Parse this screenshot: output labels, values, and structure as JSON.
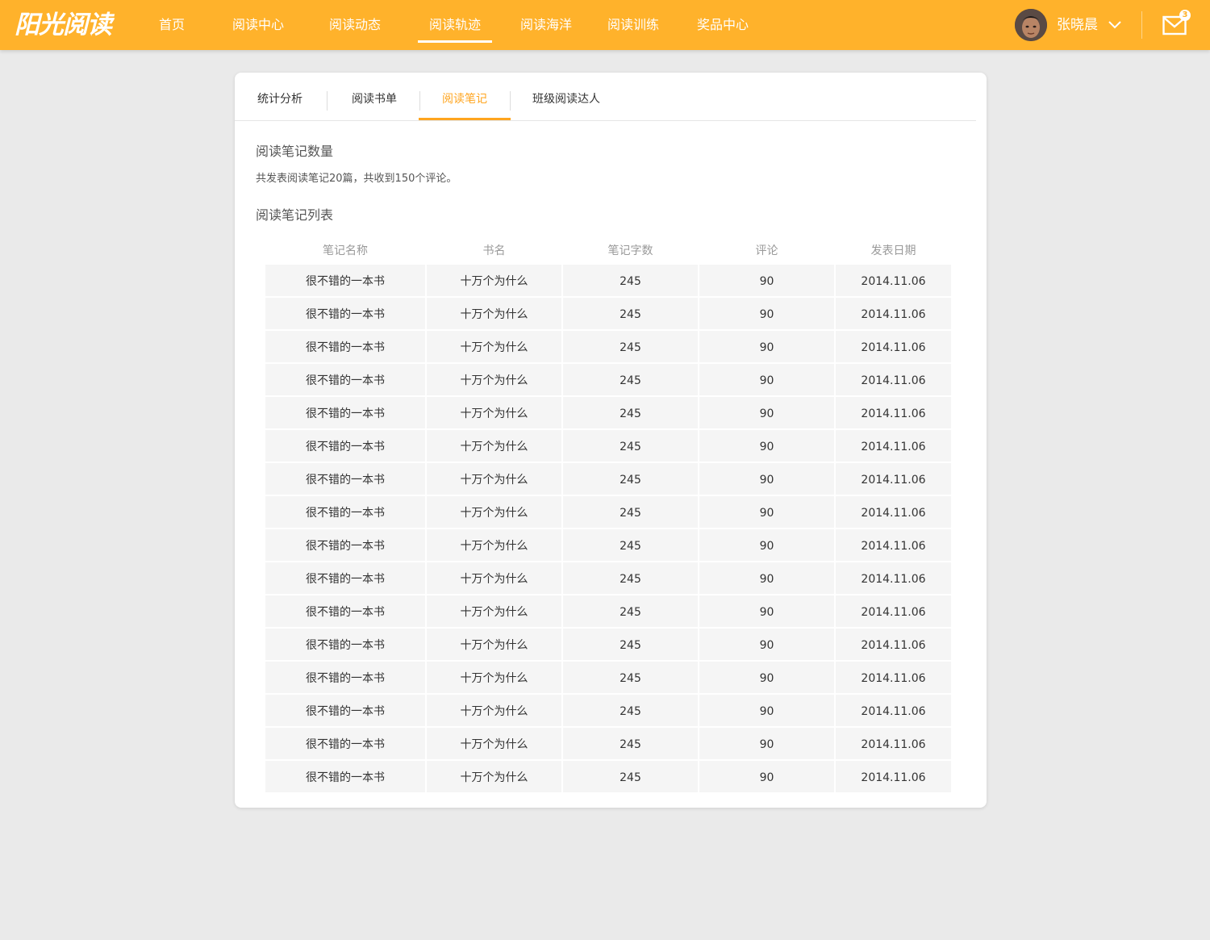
{
  "app": {
    "logo": "阳光阅读"
  },
  "nav": {
    "items": [
      {
        "label": "首页"
      },
      {
        "label": "阅读中心"
      },
      {
        "label": "阅读动态"
      },
      {
        "label": "阅读轨迹",
        "active": true
      },
      {
        "label": "阅读海洋"
      },
      {
        "label": "阅读训练"
      },
      {
        "label": "奖品中心"
      }
    ]
  },
  "user": {
    "name": "张晓晨",
    "message_count": "3"
  },
  "colors": {
    "brand": "#ffb22b",
    "accent": "#ffa51f",
    "cell_bg": "#f5f5f5",
    "page_bg": "#eaeaea"
  },
  "tabs": [
    {
      "label": "统计分析"
    },
    {
      "label": "阅读书单"
    },
    {
      "label": "阅读笔记",
      "active": true
    },
    {
      "label": "班级阅读达人"
    }
  ],
  "notes": {
    "count_title": "阅读笔记数量",
    "summary": "共发表阅读笔记20篇，共收到150个评论。",
    "list_title": "阅读笔记列表",
    "columns": [
      "笔记名称",
      "书名",
      "笔记字数",
      "评论",
      "发表日期"
    ],
    "rows": [
      [
        "很不错的一本书",
        "十万个为什么",
        "245",
        "90",
        "2014.11.06"
      ],
      [
        "很不错的一本书",
        "十万个为什么",
        "245",
        "90",
        "2014.11.06"
      ],
      [
        "很不错的一本书",
        "十万个为什么",
        "245",
        "90",
        "2014.11.06"
      ],
      [
        "很不错的一本书",
        "十万个为什么",
        "245",
        "90",
        "2014.11.06"
      ],
      [
        "很不错的一本书",
        "十万个为什么",
        "245",
        "90",
        "2014.11.06"
      ],
      [
        "很不错的一本书",
        "十万个为什么",
        "245",
        "90",
        "2014.11.06"
      ],
      [
        "很不错的一本书",
        "十万个为什么",
        "245",
        "90",
        "2014.11.06"
      ],
      [
        "很不错的一本书",
        "十万个为什么",
        "245",
        "90",
        "2014.11.06"
      ],
      [
        "很不错的一本书",
        "十万个为什么",
        "245",
        "90",
        "2014.11.06"
      ],
      [
        "很不错的一本书",
        "十万个为什么",
        "245",
        "90",
        "2014.11.06"
      ],
      [
        "很不错的一本书",
        "十万个为什么",
        "245",
        "90",
        "2014.11.06"
      ],
      [
        "很不错的一本书",
        "十万个为什么",
        "245",
        "90",
        "2014.11.06"
      ],
      [
        "很不错的一本书",
        "十万个为什么",
        "245",
        "90",
        "2014.11.06"
      ],
      [
        "很不错的一本书",
        "十万个为什么",
        "245",
        "90",
        "2014.11.06"
      ],
      [
        "很不错的一本书",
        "十万个为什么",
        "245",
        "90",
        "2014.11.06"
      ],
      [
        "很不错的一本书",
        "十万个为什么",
        "245",
        "90",
        "2014.11.06"
      ]
    ]
  }
}
